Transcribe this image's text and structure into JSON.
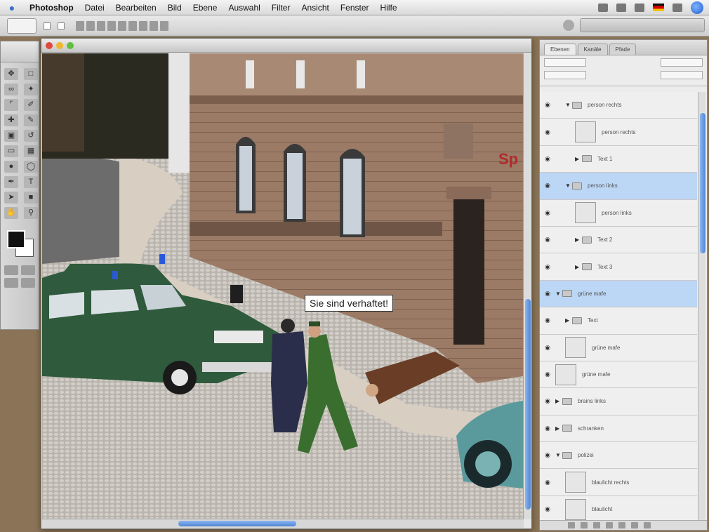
{
  "menubar": {
    "app": "Photoshop",
    "items": [
      "Datei",
      "Bearbeiten",
      "Bild",
      "Ebene",
      "Auswahl",
      "Filter",
      "Ansicht",
      "Fenster",
      "Hilfe"
    ]
  },
  "document": {
    "speech_text": "Sie sind verhaftet!"
  },
  "layers": {
    "tabs": [
      "Ebenen",
      "Kanäle",
      "Pfade"
    ],
    "items": [
      {
        "name": "person rechts",
        "type": "group",
        "expanded": true,
        "selected": false,
        "indent": 1
      },
      {
        "name": "person rechts",
        "type": "layer",
        "selected": false,
        "indent": 2
      },
      {
        "name": "Text 1",
        "type": "group",
        "expanded": false,
        "selected": false,
        "indent": 2
      },
      {
        "name": "person links",
        "type": "group",
        "expanded": true,
        "selected": true,
        "indent": 1
      },
      {
        "name": "person links",
        "type": "layer",
        "selected": false,
        "indent": 2
      },
      {
        "name": "Text 2",
        "type": "group",
        "expanded": false,
        "selected": false,
        "indent": 2
      },
      {
        "name": "Text 3",
        "type": "group",
        "expanded": false,
        "selected": false,
        "indent": 2
      },
      {
        "name": "grüne mafe",
        "type": "group",
        "expanded": true,
        "selected": true,
        "indent": 0
      },
      {
        "name": "Text",
        "type": "group",
        "expanded": false,
        "selected": false,
        "indent": 1
      },
      {
        "name": "grüne mafe",
        "type": "layer",
        "selected": false,
        "indent": 1
      },
      {
        "name": "grüne mafe",
        "type": "layer",
        "selected": false,
        "indent": 0
      },
      {
        "name": "brains links",
        "type": "group",
        "expanded": false,
        "selected": false,
        "indent": 0
      },
      {
        "name": "schranken",
        "type": "group",
        "expanded": false,
        "selected": false,
        "indent": 0
      },
      {
        "name": "polizei",
        "type": "group",
        "expanded": true,
        "selected": false,
        "indent": 0
      },
      {
        "name": "blaulicht rechts",
        "type": "layer",
        "selected": false,
        "indent": 1
      },
      {
        "name": "blaulicht",
        "type": "layer",
        "selected": false,
        "indent": 1
      }
    ]
  },
  "colors": {
    "accent": "#4f86d6",
    "selection": "#bcd6f5",
    "police_car": "#2f5a3c",
    "vw_beetle": "#5b9a9c"
  },
  "icons": [
    "apple-icon",
    "spotlight-icon",
    "eye-icon",
    "folder-icon"
  ]
}
